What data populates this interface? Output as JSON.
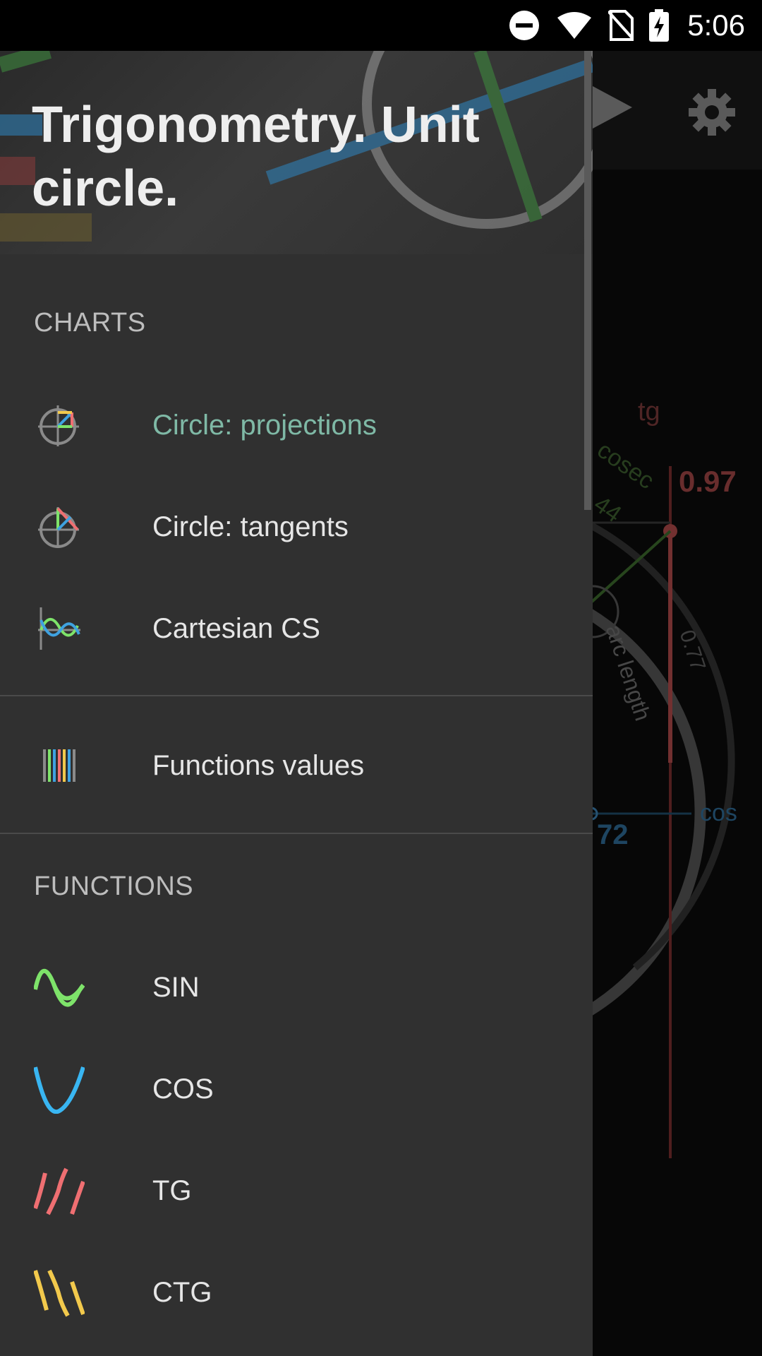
{
  "status_bar": {
    "time": "5:06"
  },
  "background_app": {
    "labels": {
      "tg": "tg",
      "tg_value": "0.97",
      "cosec": "cosec",
      "cosec_value": "44",
      "arc_length": "arc length",
      "arc_value": "0.77",
      "cos": "cos",
      "cos_value": "72"
    },
    "colors": {
      "tg": "#b04a4a",
      "cos": "#3b7fb0",
      "cosec": "#4f7f3a",
      "arc": "#7a7a7a"
    }
  },
  "drawer": {
    "title": "Trigonometry. Unit circle.",
    "sections": {
      "charts_label": "CHARTS",
      "functions_label": "FUNCTIONS"
    },
    "charts_items": [
      {
        "label": "Circle: projections",
        "icon": "circle-projections-icon",
        "active": true
      },
      {
        "label": "Circle: tangents",
        "icon": "circle-tangents-icon",
        "active": false
      },
      {
        "label": "Cartesian CS",
        "icon": "cartesian-cs-icon",
        "active": false
      }
    ],
    "values_item": {
      "label": "Functions values",
      "icon": "functions-values-icon"
    },
    "function_items": [
      {
        "label": "SIN",
        "icon": "sin-wave-icon",
        "color": "#7ee36a"
      },
      {
        "label": "COS",
        "icon": "cos-wave-icon",
        "color": "#39b6f2"
      },
      {
        "label": "TG",
        "icon": "tg-wave-icon",
        "color": "#ef6f72"
      },
      {
        "label": "CTG",
        "icon": "ctg-wave-icon",
        "color": "#f2c94c"
      }
    ],
    "active_color": "#7fb9a6"
  }
}
